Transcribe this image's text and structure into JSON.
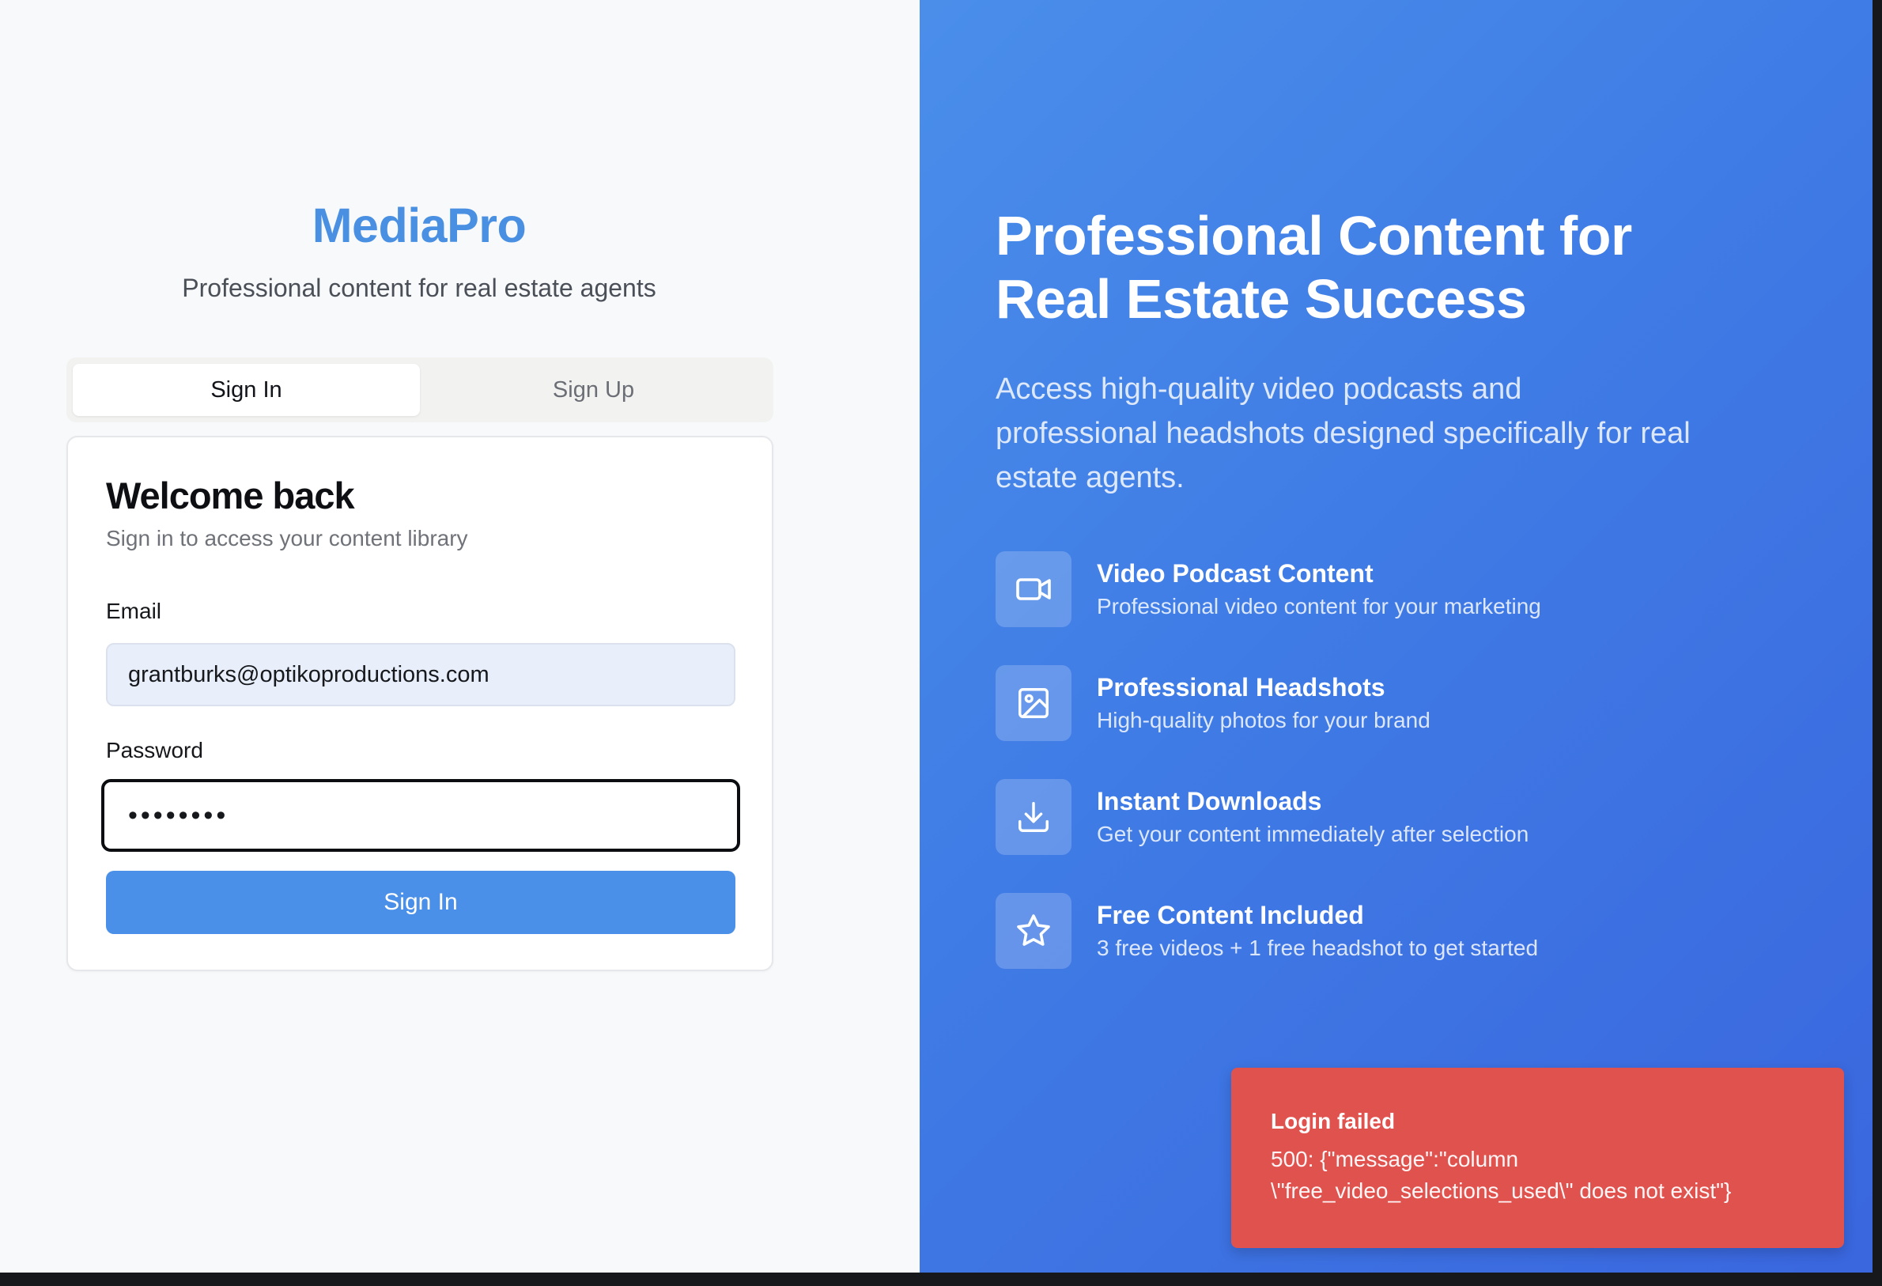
{
  "brand": {
    "name": "MediaPro",
    "tagline": "Professional content for real estate agents"
  },
  "auth_tabs": [
    {
      "label": "Sign In",
      "active": true
    },
    {
      "label": "Sign Up",
      "active": false
    }
  ],
  "signin_card": {
    "title": "Welcome back",
    "subtitle": "Sign in to access your content library",
    "email_label": "Email",
    "email_value": "grantburks@optikoproductions.com",
    "password_label": "Password",
    "password_value": "••••••••",
    "submit_label": "Sign In"
  },
  "hero": {
    "title_line1": "Professional Content for",
    "title_line2": "Real Estate Success",
    "subtitle": "Access high-quality video podcasts and professional headshots designed specifically for real estate agents."
  },
  "features": [
    {
      "icon": "video-icon",
      "title": "Video Podcast Content",
      "description": "Professional video content for your marketing"
    },
    {
      "icon": "image-icon",
      "title": "Professional Headshots",
      "description": "High-quality photos for your brand"
    },
    {
      "icon": "download-icon",
      "title": "Instant Downloads",
      "description": "Get your content immediately after selection"
    },
    {
      "icon": "star-icon",
      "title": "Free Content Included",
      "description": "3 free videos + 1 free headshot to get started"
    }
  ],
  "toast": {
    "title": "Login failed",
    "message": "500: {\"message\":\"column \\\"free_video_selections_used\\\" does not exist\"}"
  },
  "colors": {
    "brand_blue": "#4a90e2",
    "button_blue": "#4a90e8",
    "error_red": "#e0524e"
  }
}
